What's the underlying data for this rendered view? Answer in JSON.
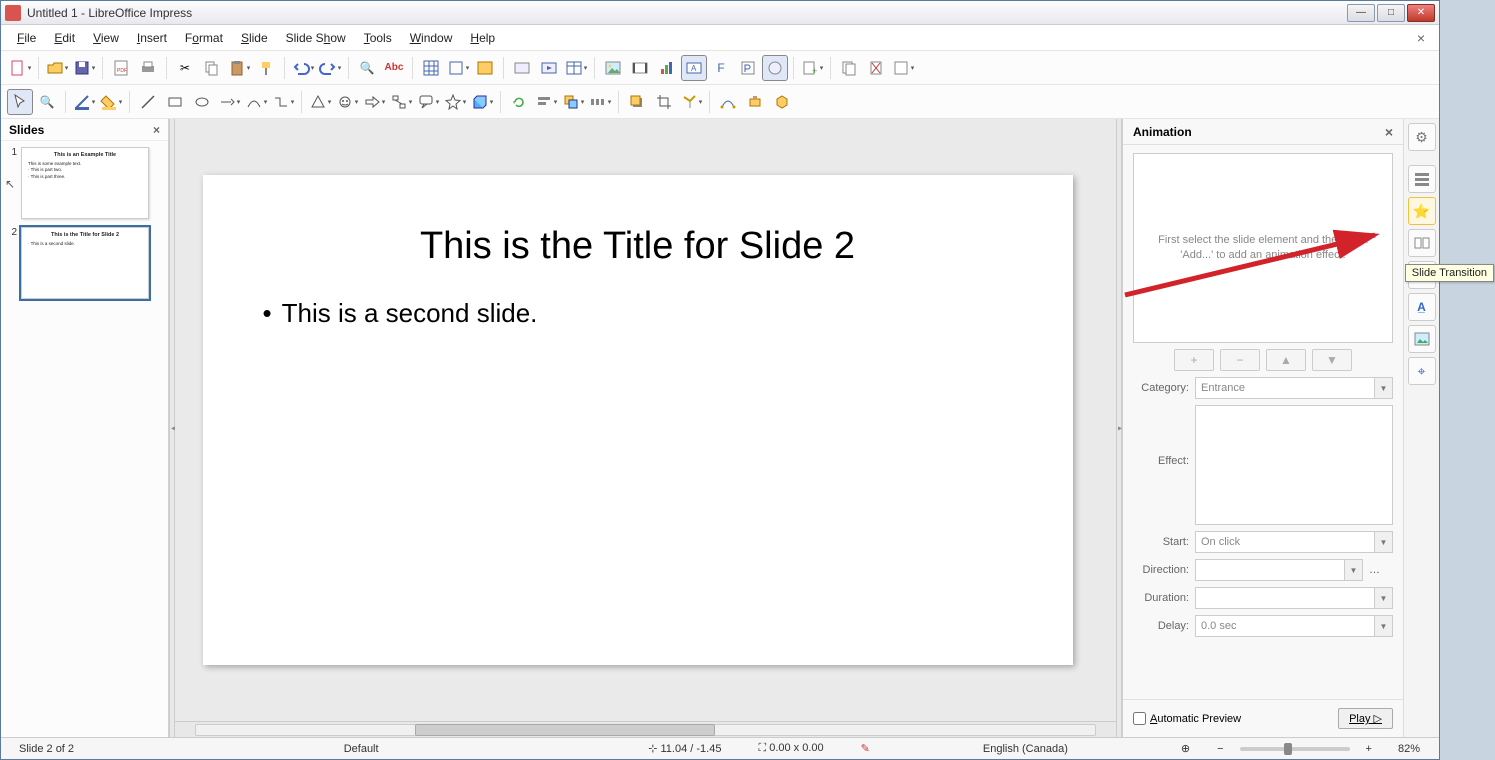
{
  "window": {
    "title": "Untitled 1 - LibreOffice Impress"
  },
  "menu": {
    "items": [
      {
        "label": "File",
        "u": 0
      },
      {
        "label": "Edit",
        "u": 0
      },
      {
        "label": "View",
        "u": 0
      },
      {
        "label": "Insert",
        "u": 0
      },
      {
        "label": "Format",
        "u": 1
      },
      {
        "label": "Slide",
        "u": 0
      },
      {
        "label": "Slide Show",
        "u": 6
      },
      {
        "label": "Tools",
        "u": 0
      },
      {
        "label": "Window",
        "u": 0
      },
      {
        "label": "Help",
        "u": 0
      }
    ]
  },
  "slides_panel": {
    "title": "Slides"
  },
  "thumbs": [
    {
      "num": "1",
      "title": "This is an Example Title",
      "body": "This is some example text.\n  · This is part two.\n  · This is part three."
    },
    {
      "num": "2",
      "title": "This is the Title for Slide 2",
      "body": "· This is a second slide.",
      "selected": true
    }
  ],
  "slide": {
    "title": "This is the Title for Slide 2",
    "body": "This is a second slide."
  },
  "animation": {
    "title": "Animation",
    "hint": "First select the slide element and then click 'Add...' to add an animation effect.",
    "category_label": "Category:",
    "category_value": "Entrance",
    "effect_label": "Effect:",
    "start_label": "Start:",
    "start_value": "On click",
    "direction_label": "Direction:",
    "duration_label": "Duration:",
    "delay_label": "Delay:",
    "delay_value": "0.0 sec",
    "auto_preview_label": "Automatic Preview",
    "play_label": "Play"
  },
  "tooltip": "Slide Transition",
  "status": {
    "slide": "Slide 2 of 2",
    "master": "Default",
    "pos": "11.04 / -1.45",
    "size": "0.00 x 0.00",
    "lang": "English (Canada)",
    "zoom": "82%"
  }
}
